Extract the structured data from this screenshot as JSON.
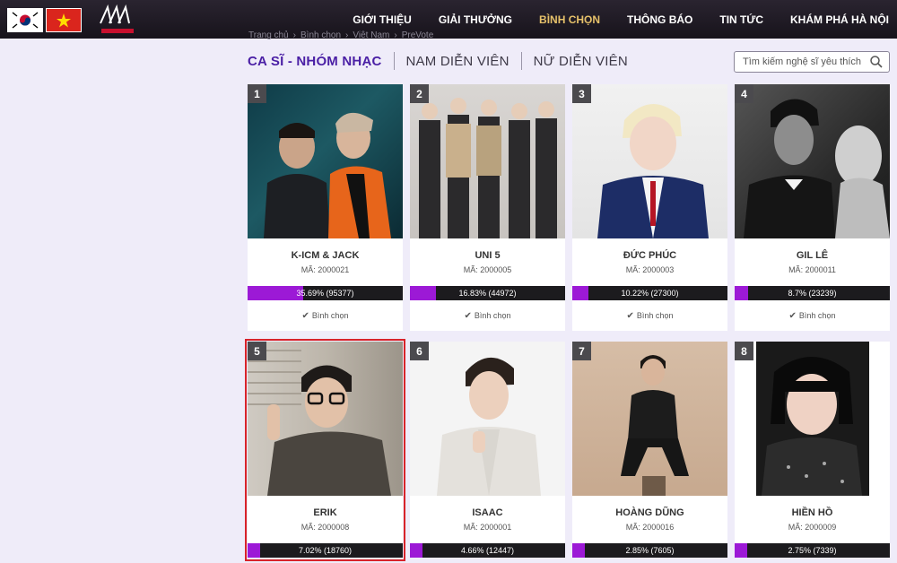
{
  "header": {
    "nav": [
      "GIỚI THIỆU",
      "GIẢI THƯỞNG",
      "BÌNH CHỌN",
      "THÔNG BÁO",
      "TIN TỨC",
      "KHÁM PHÁ HÀ NỘI"
    ],
    "active_nav": "BÌNH CHỌN",
    "flags": [
      "korea-flag-icon",
      "vietnam-flag-icon"
    ],
    "logo_text": "AAA"
  },
  "breadcrumb": [
    "Trang chủ",
    "Bình chọn",
    "Việt Nam",
    "PreVote"
  ],
  "tabs": [
    "CA SĨ - NHÓM NHẠC",
    "NAM DIỄN VIÊN",
    "NỮ DIỄN VIÊN"
  ],
  "search": {
    "placeholder": "Tìm kiếm nghệ sĩ yêu thích"
  },
  "vote_label": "Bình chọn",
  "cards": [
    {
      "rank": "1",
      "name": "K-ICM & JACK",
      "code": "MÃ: 2000021",
      "stat": "35.69% (95377)",
      "percent": 35.69
    },
    {
      "rank": "2",
      "name": "UNI 5",
      "code": "MÃ: 2000005",
      "stat": "16.83% (44972)",
      "percent": 16.83
    },
    {
      "rank": "3",
      "name": "ĐỨC PHÚC",
      "code": "MÃ: 2000003",
      "stat": "10.22% (27300)",
      "percent": 10.22
    },
    {
      "rank": "4",
      "name": "GIL LÊ",
      "code": "MÃ: 2000011",
      "stat": "8.7% (23239)",
      "percent": 8.7
    },
    {
      "rank": "5",
      "name": "ERIK",
      "code": "MÃ: 2000008",
      "stat": "7.02% (18760)",
      "percent": 7.02
    },
    {
      "rank": "6",
      "name": "ISAAC",
      "code": "MÃ: 2000001",
      "stat": "4.66% (12447)",
      "percent": 4.66
    },
    {
      "rank": "7",
      "name": "HOÀNG DŨNG",
      "code": "MÃ: 2000016",
      "stat": "2.85% (7605)",
      "percent": 2.85
    },
    {
      "rank": "8",
      "name": "HIỀN HỒ",
      "code": "MÃ: 2000009",
      "stat": "2.75% (7339)",
      "percent": 2.75
    }
  ],
  "colors": {
    "accent": "#9c19d6",
    "active_tab": "#4a1fa5",
    "nav_active": "#e6c16a",
    "selected_border": "#d8232a"
  }
}
